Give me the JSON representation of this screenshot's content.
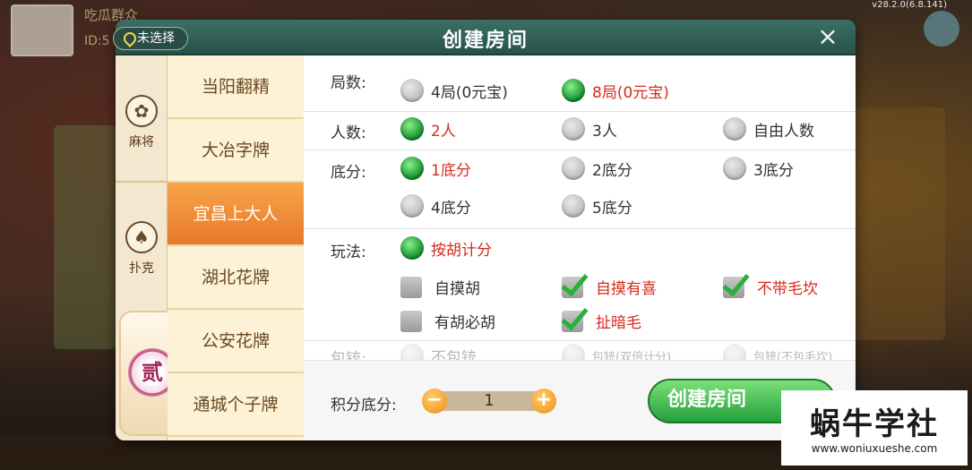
{
  "version": "v28.2.0(6.8.141)",
  "background": {
    "name": "吃瓜群众",
    "id": "ID:5"
  },
  "dialog": {
    "title": "创建房间",
    "location": "未选择",
    "close": "×"
  },
  "categories": [
    {
      "label": "麻将",
      "icon": "mahjong-icon",
      "glyph": "✿"
    },
    {
      "label": "扑克",
      "icon": "spade-icon",
      "glyph": "♠"
    },
    {
      "label": "贰",
      "icon": "number-two-badge"
    }
  ],
  "games": [
    "当阳翻精",
    "大冶字牌",
    "宜昌上大人",
    "湖北花牌",
    "公安花牌",
    "通城个子牌"
  ],
  "selected_game": "宜昌上大人",
  "options": {
    "rounds": {
      "label": "局数:",
      "choices": [
        "4局(0元宝)",
        "8局(0元宝)"
      ],
      "selected": "8局(0元宝)"
    },
    "players": {
      "label": "人数:",
      "choices": [
        "2人",
        "3人",
        "自由人数"
      ],
      "selected": "2人"
    },
    "base": {
      "label": "底分:",
      "choices": [
        "1底分",
        "2底分",
        "3底分",
        "4底分",
        "5底分"
      ],
      "selected": "1底分"
    },
    "play": {
      "label": "玩法:",
      "radio": "按胡计分",
      "checks": [
        {
          "label": "自摸胡",
          "checked": false
        },
        {
          "label": "自摸有喜",
          "checked": true
        },
        {
          "label": "不带毛坎",
          "checked": true
        },
        {
          "label": "有胡必胡",
          "checked": false
        },
        {
          "label": "扯暗毛",
          "checked": true
        }
      ]
    },
    "baojing": {
      "label": "包铳:",
      "choices": [
        "不包铳",
        "包铳(双倍计分)",
        "包铳(不包毛坎)"
      ]
    }
  },
  "bottom": {
    "score_label": "积分底分:",
    "score_value": "1",
    "minus": "−",
    "plus": "+",
    "create_label": "创建房间"
  },
  "watermark": {
    "title": "蜗牛学社",
    "url": "www.woniuxueshe.com"
  },
  "colors": {
    "accent_red": "#d62a1e",
    "selected_tab": "#e8782a",
    "title_bar": "#2e5a52",
    "create_button": "#23a03a"
  }
}
